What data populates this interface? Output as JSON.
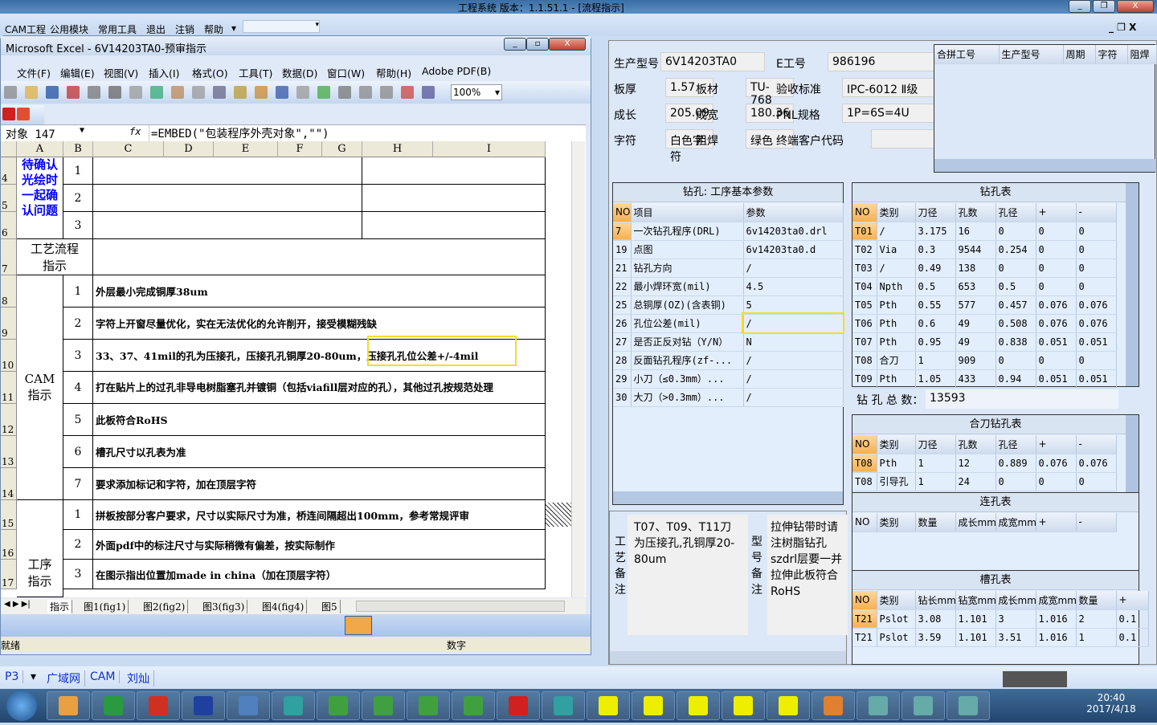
{
  "app": {
    "title": "工程系统   版本：1.1.51.1 - [流程指示]",
    "menu": [
      "CAM工程",
      "公用模块",
      "常用工具",
      "退出",
      "注销",
      "帮助"
    ]
  },
  "excel": {
    "title": "Microsoft Excel - 6V14203TA0-预审指示",
    "menu": [
      "文件(F)",
      "编辑(E)",
      "视图(V)",
      "插入(I)",
      "格式(O)",
      "工具(T)",
      "数据(D)",
      "窗口(W)",
      "帮助(H)",
      "Adobe PDF(B)"
    ],
    "zoom": "100%",
    "name_box": "对象 147",
    "formula": "=EMBED(\"包装程序外壳对象\",\"\")",
    "columns": [
      "A",
      "B",
      "C",
      "D",
      "E",
      "F",
      "G",
      "H",
      "I"
    ],
    "rows": [
      "4",
      "5",
      "6",
      "7",
      "8",
      "9",
      "10",
      "11",
      "12",
      "13",
      "14",
      "15",
      "16",
      "17"
    ],
    "confirm_label": "待确认光绘时一起确认问题",
    "confirm_nums": [
      "1",
      "2",
      "3"
    ],
    "process_label": "工艺流程指示",
    "cam_label": "CAM指示",
    "cam_items": [
      {
        "n": "1",
        "t": "外层最小完成铜厚38um"
      },
      {
        "n": "2",
        "t": "字符上开窗尽量优化，实在无法优化的允许削开，接受模糊残缺"
      },
      {
        "n": "3",
        "t": "33、37、41mil的孔为压接孔，压接孔孔铜厚20-80um，压接孔孔位公差+/-4mil"
      },
      {
        "n": "4",
        "t": "打在贴片上的过孔非导电树脂塞孔并镀铜（包括viafill层对应的孔），其他过孔按规范处理"
      },
      {
        "n": "5",
        "t": "此板符合RoHS"
      },
      {
        "n": "6",
        "t": "槽孔尺寸以孔表为准"
      },
      {
        "n": "7",
        "t": "要求添加标记和字符，加在顶层字符"
      }
    ],
    "proc_label": "工序指示",
    "proc_items": [
      {
        "n": "1",
        "t": "拼板按部分客户要求，尺寸以实际尺寸为准，桥连间隔超出100mm，参考常规评审"
      },
      {
        "n": "2",
        "t": "外面pdf中的标注尺寸与实际稍微有偏差，按实际制作"
      },
      {
        "n": "3",
        "t": "在图示指出位置加made in china（加在顶层字符）"
      }
    ],
    "link": "图1(",
    "sheets": [
      "指示",
      "图1(fig1)",
      "图2(fig2)",
      "图3(fig3)",
      "图4(fig4)",
      "图5"
    ],
    "status": "就绪",
    "status_num": "数字"
  },
  "info": {
    "fields": [
      {
        "l": "生产型号",
        "v": "6V14203TA0"
      },
      {
        "l": "E工号",
        "v": "986196"
      },
      {
        "l": "板厚",
        "v": "1.57"
      },
      {
        "l": "板材",
        "v": "TU-768"
      },
      {
        "l": "验收标准",
        "v": "IPC-6012 Ⅱ级"
      },
      {
        "l": "成长",
        "v": "205.09"
      },
      {
        "l": "成宽",
        "v": "180.36"
      },
      {
        "l": "PNL规格",
        "v": "1P=6S=4U"
      },
      {
        "l": "字符",
        "v": "白色字符"
      },
      {
        "l": "阻焊",
        "v": "绿色"
      },
      {
        "l": "终端客户代码",
        "v": ""
      }
    ],
    "merge_headers": [
      "合拼工号",
      "生产型号",
      "周期",
      "字符",
      "阻焊"
    ]
  },
  "params": {
    "title": "钻孔: 工序基本参数",
    "headers": [
      "NO",
      "项目",
      "参数"
    ],
    "rows": [
      [
        "7",
        "一次钻孔程序(DRL)",
        "6v14203ta0.drl"
      ],
      [
        "19",
        "点图",
        "6v14203ta0.d"
      ],
      [
        "21",
        "钻孔方向",
        "/"
      ],
      [
        "22",
        "最小焊环宽(mil)",
        "4.5"
      ],
      [
        "25",
        "总铜厚(OZ)(含表铜)",
        "5"
      ],
      [
        "26",
        "孔位公差(mil)",
        "/"
      ],
      [
        "27",
        "是否正反对钻（Y/N）",
        "N"
      ],
      [
        "28",
        "反面钻孔程序(zf-...",
        "/"
      ],
      [
        "29",
        "小刀（≤0.3mm）...",
        "/"
      ],
      [
        "30",
        "大刀（>0.3mm）...",
        "/"
      ]
    ]
  },
  "drill": {
    "title": "钻孔表",
    "headers": [
      "NO",
      "类别",
      "刀径",
      "孔数",
      "孔径",
      "+",
      "-"
    ],
    "rows": [
      [
        "T01",
        "/",
        "3.175",
        "16",
        "0",
        "0",
        "0"
      ],
      [
        "T02",
        "Via",
        "0.3",
        "9544",
        "0.254",
        "0",
        "0"
      ],
      [
        "T03",
        "/",
        "0.49",
        "138",
        "0",
        "0",
        "0"
      ],
      [
        "T04",
        "Npth",
        "0.5",
        "653",
        "0.5",
        "0",
        "0"
      ],
      [
        "T05",
        "Pth",
        "0.55",
        "577",
        "0.457",
        "0.076",
        "0.076"
      ],
      [
        "T06",
        "Pth",
        "0.6",
        "49",
        "0.508",
        "0.076",
        "0.076"
      ],
      [
        "T07",
        "Pth",
        "0.95",
        "49",
        "0.838",
        "0.051",
        "0.051"
      ],
      [
        "T08",
        "合刀",
        "1",
        "909",
        "0",
        "0",
        "0"
      ],
      [
        "T09",
        "Pth",
        "1.05",
        "433",
        "0.94",
        "0.051",
        "0.051"
      ]
    ],
    "total_label": "钻 孔 总 数：",
    "total": "13593"
  },
  "merge": {
    "title": "合刀钻孔表",
    "headers": [
      "NO",
      "类别",
      "刀径",
      "孔数",
      "孔径",
      "+",
      "-"
    ],
    "rows": [
      [
        "T08",
        "Pth",
        "1",
        "12",
        "0.889",
        "0.076",
        "0.076"
      ],
      [
        "T08",
        "引导孔",
        "1",
        "24",
        "0",
        "0",
        "0"
      ]
    ]
  },
  "link": {
    "title": "连孔表",
    "headers": [
      "NO",
      "类别",
      "数量",
      "成长mm",
      "成宽mm",
      "+",
      "-"
    ]
  },
  "slot": {
    "title": "槽孔表",
    "headers": [
      "NO",
      "类别",
      "钻长mm",
      "钻宽mm",
      "成长mm",
      "成宽mm",
      "数量",
      "+"
    ],
    "rows": [
      [
        "T21",
        "Pslot",
        "3.08",
        "1.101",
        "3",
        "1.016",
        "2",
        "0.1"
      ],
      [
        "T21",
        "Pslot",
        "3.59",
        "1.101",
        "3.51",
        "1.016",
        "1",
        "0.1"
      ]
    ]
  },
  "notes": {
    "proc_label": "工艺备注",
    "proc_text": "T07、T09、T11刀为压接孔,孔铜厚20-80um",
    "model_label": "型号备注",
    "model_text": "拉伸钻带时请注树脂钻孔szdrl层要一并拉伸此板符合RoHS"
  },
  "strip": {
    "p": "P3",
    "items": [
      "广域网",
      "CAM",
      "刘灿"
    ]
  },
  "clock": {
    "time": "20:40",
    "date": "2017/4/18"
  },
  "colors": {
    "accent": "#f6b050",
    "highlight": "#f0e020",
    "blue_text": "#0000ff"
  }
}
